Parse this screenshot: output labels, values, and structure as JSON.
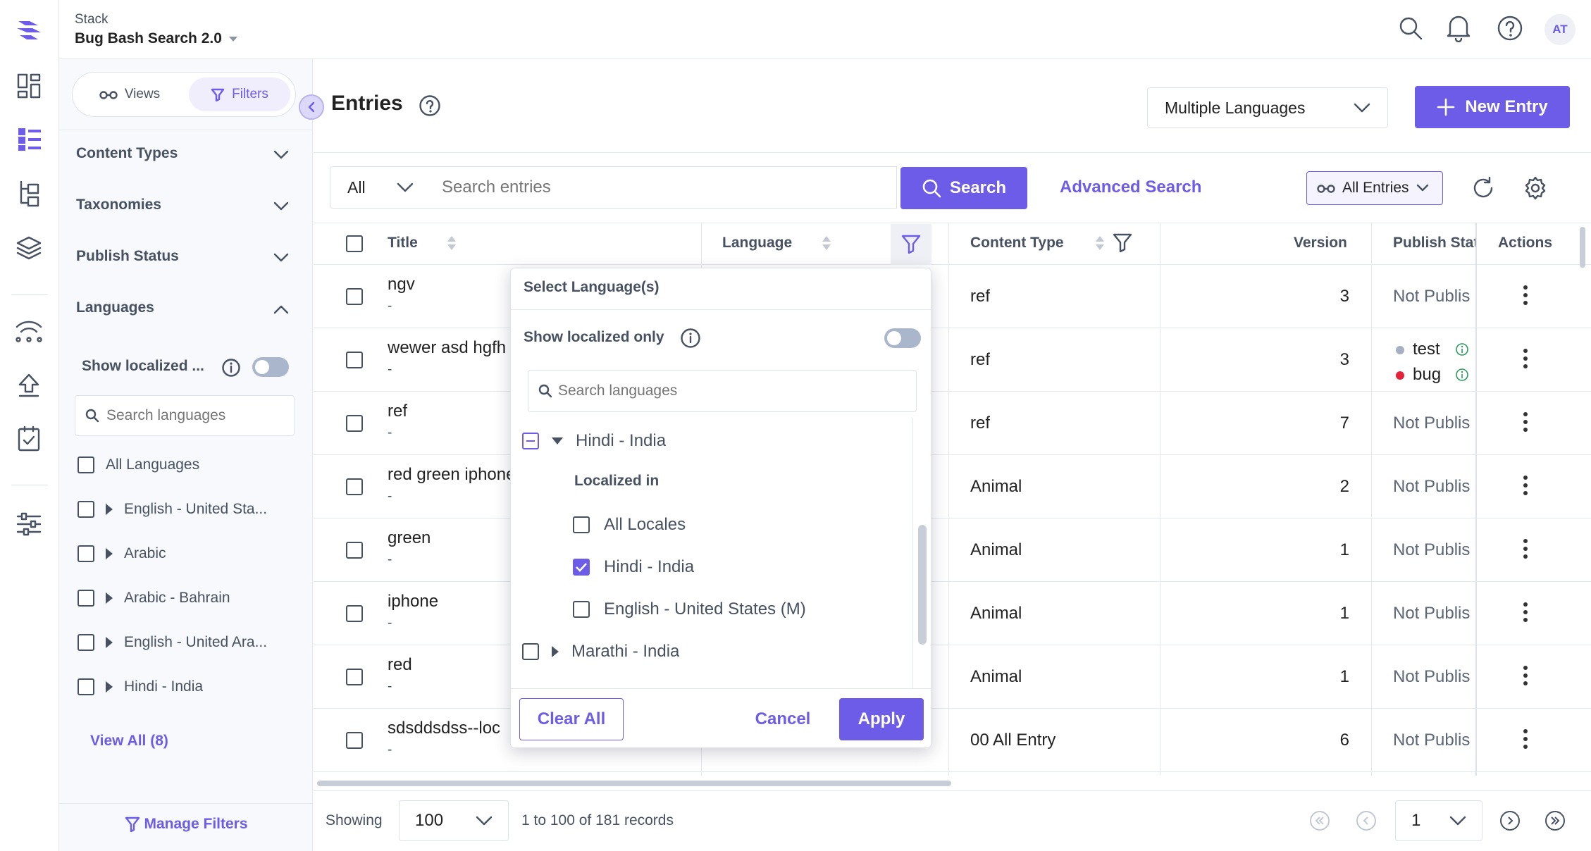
{
  "app": {
    "org": "Stack",
    "project": "Bug Bash Search 2.0",
    "avatar": "AT"
  },
  "sidebar": {
    "tabs": {
      "views": "Views",
      "filters": "Filters"
    },
    "sections": [
      "Content Types",
      "Taxonomies",
      "Publish Status",
      "Languages"
    ],
    "show_localized": "Show localized ...",
    "search_placeholder": "Search languages",
    "languages": [
      "All Languages",
      "English - United Sta...",
      "Arabic",
      "Arabic - Bahrain",
      "English - United Ara...",
      "Hindi - India"
    ],
    "view_all": "View All (8)",
    "manage_filters": "Manage Filters"
  },
  "page": {
    "title": "Entries",
    "language_select": "Multiple Languages",
    "new_entry": "New Entry"
  },
  "search": {
    "scope": "All",
    "placeholder": "Search entries",
    "button": "Search",
    "advanced": "Advanced Search",
    "view": "All Entries"
  },
  "table": {
    "columns": {
      "title": "Title",
      "language": "Language",
      "content_type": "Content Type",
      "version": "Version",
      "publish_status": "Publish Stat",
      "actions": "Actions"
    },
    "rows": [
      {
        "title": "ngv",
        "sub": "-",
        "content_type": "ref",
        "version": "3",
        "status": "Not Publis"
      },
      {
        "title": "wewer asd hgfh",
        "sub": "-",
        "content_type": "ref",
        "version": "3",
        "status": ""
      },
      {
        "title": "ref",
        "sub": "-",
        "content_type": "ref",
        "version": "7",
        "status": "Not Publis"
      },
      {
        "title": "red green iphone",
        "sub": "-",
        "content_type": "Animal",
        "version": "2",
        "status": "Not Publis"
      },
      {
        "title": "green",
        "sub": "-",
        "content_type": "Animal",
        "version": "1",
        "status": "Not Publis"
      },
      {
        "title": "iphone",
        "sub": "-",
        "content_type": "Animal",
        "version": "1",
        "status": "Not Publis"
      },
      {
        "title": "red",
        "sub": "-",
        "content_type": "Animal",
        "version": "1",
        "status": "Not Publis"
      },
      {
        "title": "sdsddsdss--loc",
        "sub": "-",
        "content_type": "00 All Entry",
        "version": "6",
        "status": "Not Publis"
      }
    ],
    "row2_statuses": [
      "test",
      "bug"
    ],
    "colors": {
      "test": "#a5b1c2",
      "bug": "#e5223a"
    }
  },
  "popup": {
    "title": "Select Language(s)",
    "show_localized": "Show localized only",
    "search_placeholder": "Search languages",
    "hindi": "Hindi - India",
    "localized_in": "Localized in",
    "locales": [
      "All Locales",
      "Hindi - India",
      "English - United States (M)"
    ],
    "marathi": "Marathi - India",
    "clear_all": "Clear All",
    "cancel": "Cancel",
    "apply": "Apply"
  },
  "footer": {
    "showing": "Showing",
    "page_size": "100",
    "records": "1 to 100 of 181 records",
    "page": "1"
  },
  "colors": {
    "accent": "#6c5ce7"
  }
}
